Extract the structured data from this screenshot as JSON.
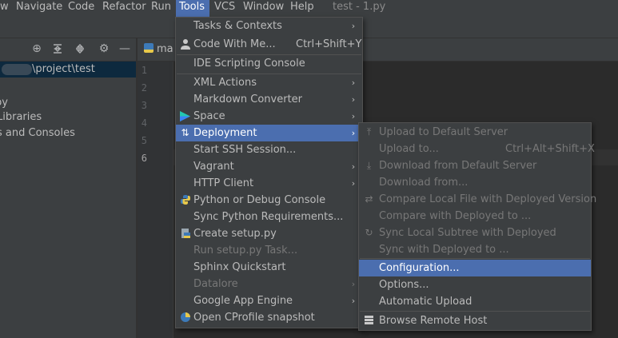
{
  "menubar": {
    "items": [
      "w",
      "Navigate",
      "Code",
      "Refactor",
      "Run",
      "Tools",
      "VCS",
      "Window",
      "Help"
    ],
    "title": "test - 1.py"
  },
  "project": {
    "path_text": "\\project\\test",
    "rows": [
      "py",
      "Libraries",
      "s and Consoles"
    ]
  },
  "editor": {
    "tab_label": "ma",
    "line_numbers": [
      "1",
      "2",
      "3",
      "4",
      "5",
      "6"
    ]
  },
  "tools_menu": {
    "items": [
      {
        "label": "Tasks & Contexts",
        "submenu": true
      },
      {
        "label": "Code With Me...",
        "shortcut": "Ctrl+Shift+Y",
        "icon": "user-icon"
      },
      {
        "label": "IDE Scripting Console"
      },
      {
        "label": "XML Actions",
        "submenu": true
      },
      {
        "label": "Markdown Converter",
        "submenu": true
      },
      {
        "label": "Space",
        "submenu": true,
        "icon": "space-icon"
      },
      {
        "label": "Deployment",
        "submenu": true,
        "icon": "deployment-icon"
      },
      {
        "label": "Start SSH Session..."
      },
      {
        "label": "Vagrant",
        "submenu": true
      },
      {
        "label": "HTTP Client",
        "submenu": true
      },
      {
        "label": "Python or Debug Console",
        "icon": "python-icon"
      },
      {
        "label": "Sync Python Requirements..."
      },
      {
        "label": "Create setup.py",
        "icon": "python-file-icon"
      },
      {
        "label": "Run setup.py Task..."
      },
      {
        "label": "Sphinx Quickstart"
      },
      {
        "label": "Datalore",
        "submenu": true
      },
      {
        "label": "Google App Engine",
        "submenu": true
      },
      {
        "label": "Open CProfile snapshot",
        "icon": "cprofile-icon"
      }
    ]
  },
  "deployment_menu": {
    "items": [
      {
        "label": "Upload to Default Server",
        "icon": "upload-icon"
      },
      {
        "label": "Upload to...",
        "shortcut": "Ctrl+Alt+Shift+X"
      },
      {
        "label": "Download from Default Server",
        "icon": "download-icon"
      },
      {
        "label": "Download from..."
      },
      {
        "label": "Compare Local File with Deployed Version",
        "icon": "compare-icon"
      },
      {
        "label": "Compare with Deployed to ..."
      },
      {
        "label": "Sync Local Subtree with Deployed",
        "icon": "sync-icon"
      },
      {
        "label": "Sync with Deployed to ..."
      },
      {
        "label": "Configuration..."
      },
      {
        "label": "Options..."
      },
      {
        "label": "Automatic Upload"
      },
      {
        "label": "Browse Remote Host",
        "icon": "server-icon"
      }
    ]
  },
  "colors": {
    "menu_bg": "#3c3f41",
    "highlight": "#4b6eaf",
    "editor_bg": "#2b2b2b",
    "disabled_text": "#777777"
  }
}
